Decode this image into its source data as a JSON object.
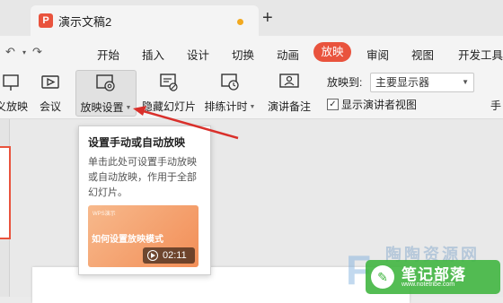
{
  "tab": {
    "logo": "P",
    "title": "演示文稿2",
    "new_tab": "+"
  },
  "quick_access": {
    "undo": "↶",
    "redo": "↷"
  },
  "menu": {
    "items": [
      "开始",
      "插入",
      "设计",
      "切换",
      "动画",
      "放映",
      "审阅",
      "视图",
      "开发工具"
    ],
    "active": "放映"
  },
  "ribbon": {
    "custom_show": "义放映",
    "meeting": "会议",
    "slideshow_settings": "放映设置",
    "hide_slide": "隐藏幻灯片",
    "rehearse_timing": "排练计时",
    "speaker_notes": "演讲备注",
    "play_to_label": "放映到:",
    "play_to_value": "主要显示器",
    "presenter_view": "显示演讲者视图",
    "presenter_checked": "✓",
    "more": "手"
  },
  "tooltip": {
    "title": "设置手动或自动放映",
    "description": "单击此处可设置手动放映或自动放映，作用于全部幻灯片。",
    "video_small": "WPS演示",
    "video_title": "如何设置放映模式",
    "video_duration": "02:11"
  },
  "watermark": {
    "line1": "陶陶资源网",
    "badge": "笔记部落",
    "url": "www.notetribe.com",
    "circle": "✎",
    "f_glyph": "F"
  },
  "colors": {
    "accent": "#e9533d",
    "arrow": "#d9302b"
  }
}
